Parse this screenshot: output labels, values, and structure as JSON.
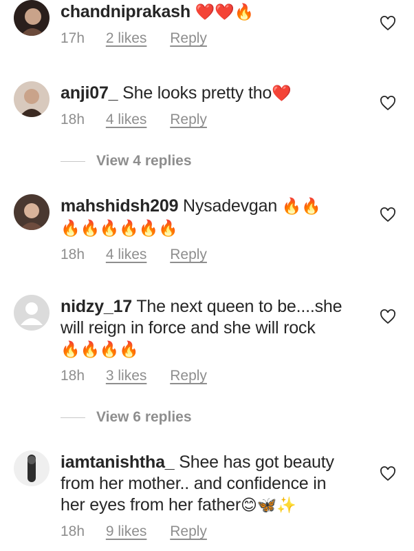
{
  "comments": [
    {
      "user": "chandniprakash",
      "text": "",
      "emoji": "❤️❤️🔥",
      "time": "17h",
      "likes": "2 likes",
      "reply": "Reply"
    },
    {
      "user": "anji07_",
      "text": "She looks pretty tho",
      "emoji": "❤️",
      "time": "18h",
      "likes": "4 likes",
      "reply": "Reply"
    },
    {
      "user": "mahshidsh209",
      "text": "Nysadevgan",
      "emoji": "🔥🔥",
      "emoji2": "🔥🔥🔥🔥🔥🔥",
      "time": "18h",
      "likes": "4 likes",
      "reply": "Reply"
    },
    {
      "user": "nidzy_17",
      "text": "The next queen to be....she",
      "text2": "will reign in force and she will rock",
      "emoji": "🔥🔥🔥🔥",
      "time": "18h",
      "likes": "3 likes",
      "reply": "Reply"
    },
    {
      "user": "iamtanishtha_",
      "text": "Shee has got beauty",
      "text2": "from her mother.. and confidence in",
      "text3": "her eyes from her father",
      "emoji": "😊🦋✨",
      "time": "18h",
      "likes": "9 likes",
      "reply": "Reply"
    }
  ],
  "view_replies": [
    "View 4 replies",
    "View 6 replies"
  ],
  "colors": {
    "text": "#262626",
    "meta": "#8e8e8e"
  }
}
